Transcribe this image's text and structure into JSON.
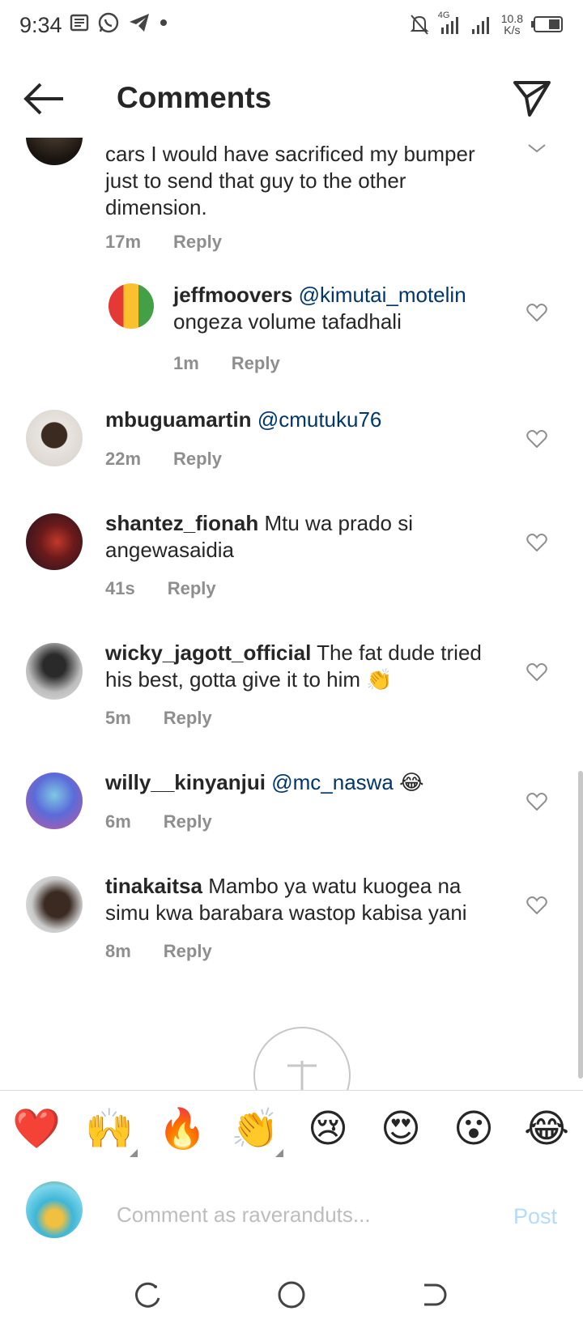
{
  "status": {
    "time": "9:34",
    "network": "4G",
    "speed_value": "10.8",
    "speed_unit": "K/s"
  },
  "header": {
    "title": "Comments"
  },
  "comments": [
    {
      "username": "",
      "mention": "",
      "text": "cars I would have sacrificed my bumper just to send that guy to the other dimension.",
      "time": "17m",
      "reply_label": "Reply"
    },
    {
      "username": "jeffmoovers",
      "mention": "@kimutai_motelin",
      "text": "ongeza volume tafadhali",
      "time": "1m",
      "reply_label": "Reply"
    },
    {
      "username": "mbuguamartin",
      "mention": "@cmutuku76",
      "text": "",
      "time": "22m",
      "reply_label": "Reply"
    },
    {
      "username": "shantez_fionah",
      "mention": "",
      "text": "Mtu wa prado si angewasaidia",
      "time": "41s",
      "reply_label": "Reply"
    },
    {
      "username": "wicky_jagott_official",
      "mention": "",
      "text": "The fat dude tried his best, gotta give it to him 👏",
      "time": "5m",
      "reply_label": "Reply"
    },
    {
      "username": "willy__kinyanjui",
      "mention": "@mc_naswa",
      "text": "😂",
      "time": "6m",
      "reply_label": "Reply"
    },
    {
      "username": "tinakaitsa",
      "mention": "",
      "text": "Mambo ya watu kuogea na simu kwa barabara wastop kabisa yani",
      "time": "8m",
      "reply_label": "Reply"
    }
  ],
  "emoji_bar": [
    "❤️",
    "🙌",
    "🔥",
    "👏",
    "😢",
    "😍",
    "😮",
    "😂"
  ],
  "compose": {
    "placeholder": "Comment as raveranduts...",
    "post_label": "Post"
  },
  "colors": {
    "mention": "#00376b",
    "meta": "#8e8e8e",
    "post_disabled": "#b3dbff"
  }
}
